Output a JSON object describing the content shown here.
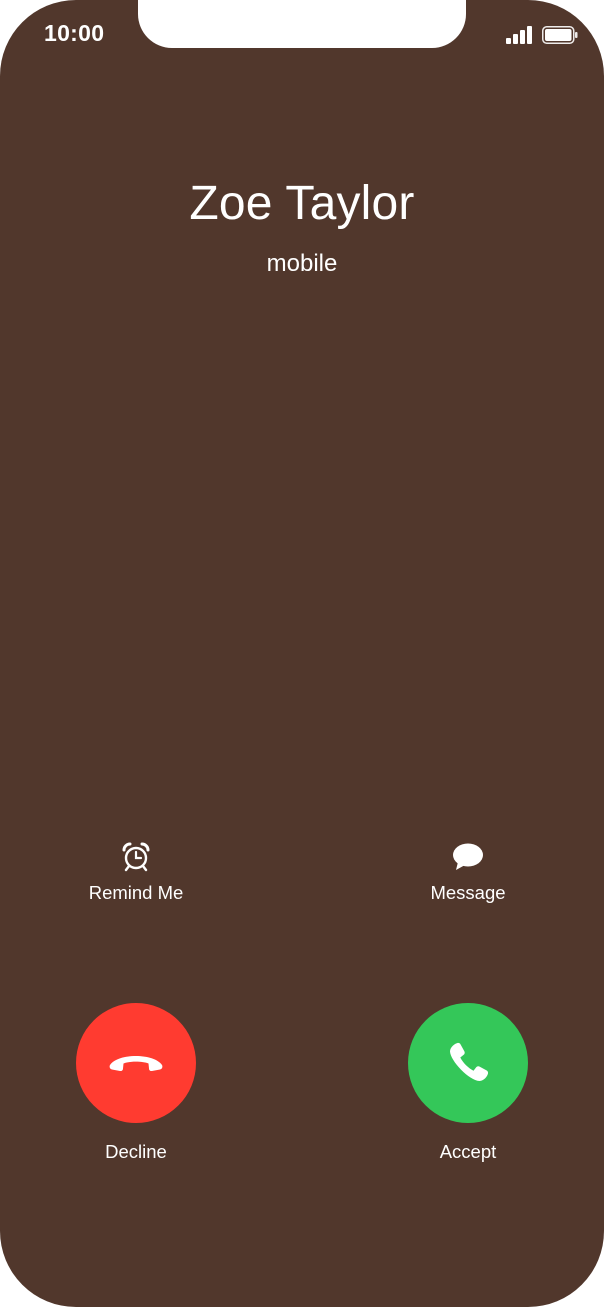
{
  "status_bar": {
    "time": "10:00",
    "signal_icon": "cellular-signal-icon",
    "battery_icon": "battery-icon"
  },
  "caller": {
    "name": "Zoe Taylor",
    "label": "mobile"
  },
  "actions": {
    "remind": {
      "label": "Remind Me",
      "icon": "alarm-clock-icon"
    },
    "message": {
      "label": "Message",
      "icon": "speech-bubble-icon"
    }
  },
  "call_buttons": {
    "decline": {
      "label": "Decline",
      "icon": "phone-hangup-icon",
      "color": "#ff3b30"
    },
    "accept": {
      "label": "Accept",
      "icon": "phone-icon",
      "color": "#34c759"
    }
  },
  "colors": {
    "background": "#51372c",
    "text": "#ffffff"
  }
}
